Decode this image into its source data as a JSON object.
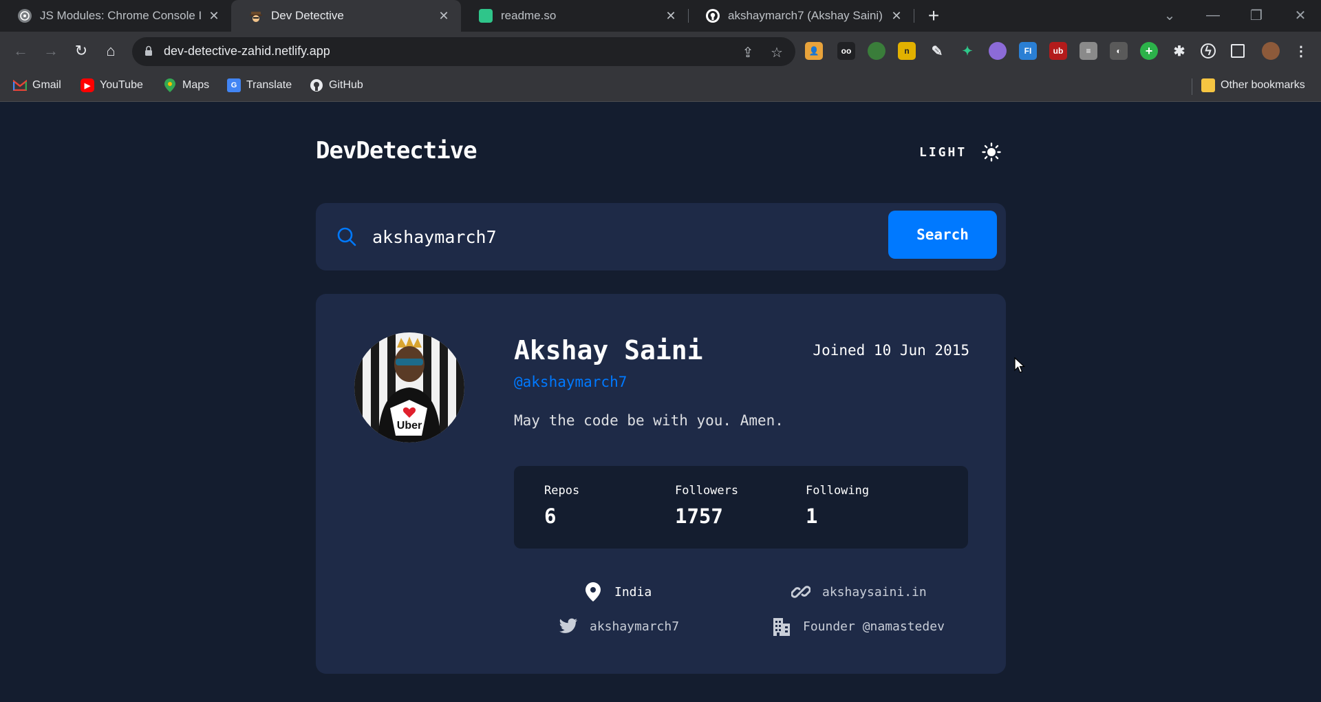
{
  "browser": {
    "tabs": [
      {
        "title": "JS Modules: Chrome Console Issu",
        "favicon": "chatgpt-icon"
      },
      {
        "title": "Dev Detective",
        "favicon": "detective-icon"
      },
      {
        "title": "readme.so",
        "favicon": "readme-icon"
      },
      {
        "title": "akshaymarch7 (Akshay Saini)",
        "favicon": "github-icon"
      }
    ],
    "active_tab": 1,
    "url": "dev-detective-zahid.netlify.app",
    "bookmarks": [
      {
        "label": "Gmail",
        "icon": "gmail-icon"
      },
      {
        "label": "YouTube",
        "icon": "youtube-icon"
      },
      {
        "label": "Maps",
        "icon": "maps-icon"
      },
      {
        "label": "Translate",
        "icon": "translate-icon"
      },
      {
        "label": "GitHub",
        "icon": "github-icon"
      }
    ],
    "other_bookmarks": "Other bookmarks"
  },
  "app": {
    "logo": "DevDetective",
    "theme_label": "LIGHT",
    "search": {
      "value": "akshaymarch7",
      "button_label": "Search"
    },
    "profile": {
      "name": "Akshay Saini",
      "joined": "Joined 10 Jun 2015",
      "handle": "@akshaymarch7",
      "bio": "May the code be with you. Amen.",
      "stats": {
        "repos_label": "Repos",
        "repos": "6",
        "followers_label": "Followers",
        "followers": "1757",
        "following_label": "Following",
        "following": "1"
      },
      "location": "India",
      "website": "akshaysaini.in",
      "twitter": "akshaymarch7",
      "company": "Founder @namastedev"
    }
  },
  "colors": {
    "page_bg": "#141d2f",
    "card_bg": "#1e2a47",
    "accent": "#0079ff",
    "text": "#ffffff"
  }
}
